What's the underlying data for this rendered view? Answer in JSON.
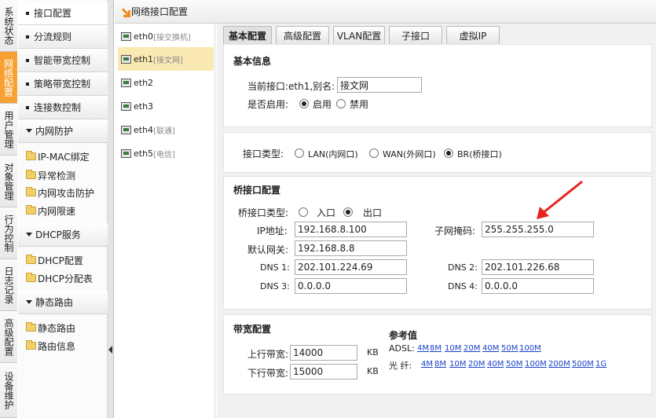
{
  "vtabs": [
    "系统状态",
    "网络配置",
    "用户管理",
    "对象管理",
    "行为控制",
    "日志记录",
    "高级配置",
    "设备维护"
  ],
  "menu": {
    "items": [
      "接口配置",
      "分流规则",
      "智能带宽控制",
      "策略带宽控制",
      "连接数控制"
    ],
    "lan_protect": "内网防护",
    "lan_sub": [
      "IP-MAC绑定",
      "异常检测",
      "内网攻击防护",
      "内网限速"
    ],
    "dhcp": "DHCP服务",
    "dhcp_sub": [
      "DHCP配置",
      "DHCP分配表"
    ],
    "static_route": "静态路由",
    "route_sub": [
      "静态路由",
      "路由信息"
    ]
  },
  "title": "网络接口配置",
  "interfaces": [
    {
      "name": "eth0",
      "tag": "[接交换机]"
    },
    {
      "name": "eth1",
      "tag": "[接文网]"
    },
    {
      "name": "eth2",
      "tag": ""
    },
    {
      "name": "eth3",
      "tag": ""
    },
    {
      "name": "eth4",
      "tag": "[联通]"
    },
    {
      "name": "eth5",
      "tag": "[电信]"
    }
  ],
  "tabs": [
    "基本配置",
    "高级配置",
    "VLAN配置",
    "子接口",
    "虚拟IP"
  ],
  "basic": {
    "section_title": "基本信息",
    "current_iface_label": "当前接口:eth1,别名:",
    "alias_value": "接文网",
    "enable_label": "是否启用:",
    "enable_on": "启用",
    "enable_off": "禁用"
  },
  "iface_type": {
    "label": "接口类型:",
    "lan": "LAN(内网口)",
    "wan": "WAN(外网口)",
    "br": "BR(桥接口)"
  },
  "bridge": {
    "section_title": "桥接口配置",
    "type_label": "桥接口类型:",
    "in": "入口",
    "out": "出口",
    "ip_label": "IP地址:",
    "ip_value": "192.168.8.100",
    "mask_label": "子网掩码:",
    "mask_value": "255.255.255.0",
    "gw_label": "默认网关:",
    "gw_value": "192.168.8.8",
    "dns1_label": "DNS 1:",
    "dns1_value": "202.101.224.69",
    "dns2_label": "DNS 2:",
    "dns2_value": "202.101.226.68",
    "dns3_label": "DNS 3:",
    "dns3_value": "0.0.0.0",
    "dns4_label": "DNS 4:",
    "dns4_value": "0.0.0.0"
  },
  "bandwidth": {
    "section_title": "带宽配置",
    "up_label": "上行带宽:",
    "up_value": "14000",
    "down_label": "下行带宽:",
    "down_value": "15000",
    "unit": "KB",
    "ref_title": "参考值",
    "adsl_label": "ADSL:",
    "adsl_links": [
      "4M",
      "8M",
      "10M",
      "20M",
      "40M",
      "50M",
      "100M"
    ],
    "fiber_label": "光 纤:",
    "fiber_links": [
      "4M",
      "8M",
      "10M",
      "20M",
      "40M",
      "50M",
      "100M",
      "200M",
      "500M",
      "1G"
    ]
  },
  "colors": {
    "accent": "#f7a133",
    "annotation_arrow": "#e8231f",
    "link": "#1a43c9"
  }
}
